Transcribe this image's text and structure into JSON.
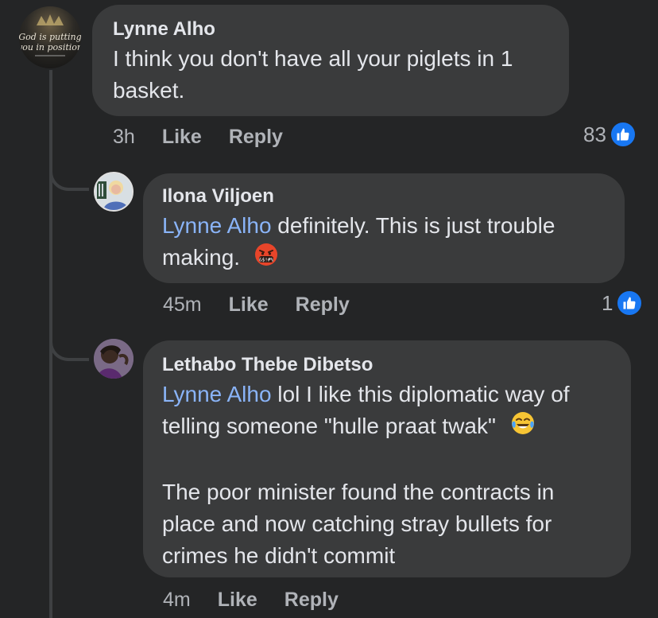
{
  "comments": [
    {
      "author": "Lynne Alho",
      "avatar_text_line1": "God is putting",
      "avatar_text_line2": "you in position",
      "text_line1": "I think you don't have all your piglets in 1",
      "text_line2": "basket.",
      "time": "3h",
      "like_label": "Like",
      "reply_label": "Reply",
      "reaction_count": "83"
    },
    {
      "author": "Ilona Viljoen",
      "mention": "Lynne Alho",
      "text_line1_rest": " definitely.  This is just trouble",
      "text_line2": "making.",
      "emoji_name": "angry-cursing-face-emoji",
      "time": "45m",
      "like_label": "Like",
      "reply_label": "Reply",
      "reaction_count": "1"
    },
    {
      "author": "Lethabo Thebe Dibetso",
      "mention": "Lynne Alho",
      "text_line1_rest": " lol I like this diplomatic way of",
      "text_line2": "telling someone \"hulle praat twak\"",
      "emoji_name": "tears-of-joy-emoji",
      "text_para2_line1": "The poor minister found the contracts in",
      "text_para2_line2": "place and now catching stray bullets for",
      "text_para2_line3": "crimes he didn't commit",
      "time": "4m",
      "like_label": "Like",
      "reply_label": "Reply"
    }
  ],
  "colors": {
    "background": "#242526",
    "bubble": "#3a3b3c",
    "mention": "#8ab4f8",
    "like_blue": "#1877f2",
    "secondary_text": "#b0b3b8"
  },
  "icons": [
    "like-icon",
    "angry-cursing-face-emoji",
    "tears-of-joy-emoji"
  ]
}
